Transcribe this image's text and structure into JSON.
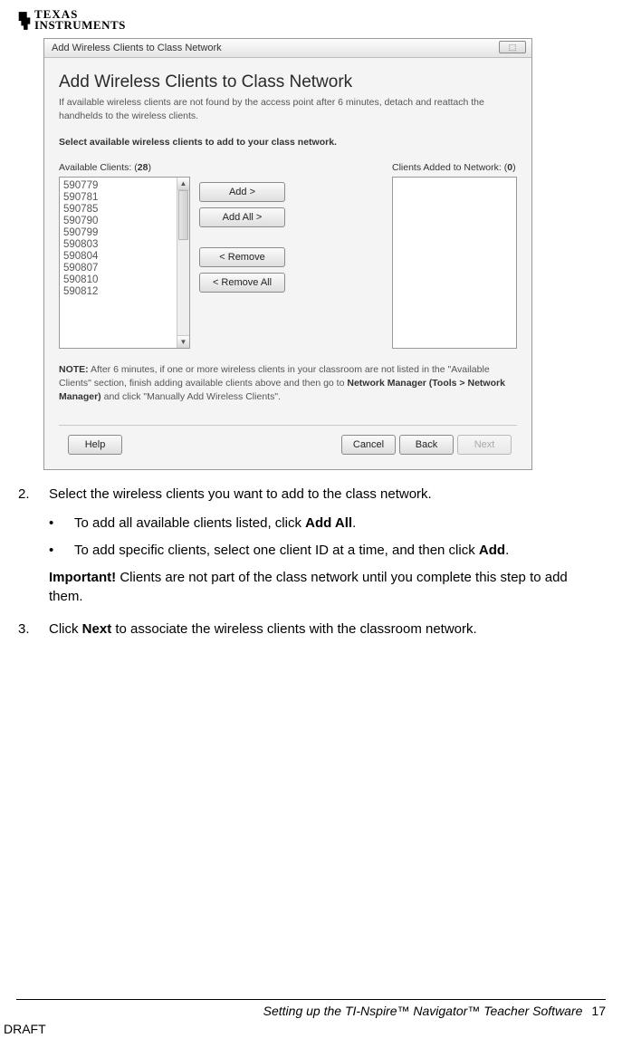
{
  "logo": {
    "line1": "TEXAS",
    "line2": "INSTRUMENTS"
  },
  "dialog": {
    "titlebar": "Add Wireless Clients to Class Network",
    "close_glyph": "⬚",
    "heading": "Add Wireless Clients to Class Network",
    "sub": "If available wireless clients are not found by the access point after 6 minutes, detach and reattach the handhelds to the wireless clients.",
    "instruction": "Select available wireless clients to add to your class network.",
    "avail_label": "Available Clients: (",
    "avail_count": "28",
    "avail_close": ")",
    "added_label": "Clients Added to Network: (",
    "added_count": "0",
    "added_close": ")",
    "clients": [
      "590779",
      "590781",
      "590785",
      "590790",
      "590799",
      "590803",
      "590804",
      "590807",
      "590810",
      "590812"
    ],
    "btn_add": "Add >",
    "btn_addall": "Add All >",
    "btn_remove": "< Remove",
    "btn_removeall": "< Remove All",
    "note_label": "NOTE:",
    "note_text": "  After 6 minutes, if one or more wireless clients in your classroom are not listed in the \"Available Clients\" section, finish adding available clients above and then go to ",
    "note_bold": "Network Manager (Tools > Network Manager)",
    "note_tail": " and click \"Manually Add Wireless Clients\".",
    "help": "Help",
    "cancel": "Cancel",
    "back": "Back",
    "next": "Next"
  },
  "steps": {
    "s2num": "2.",
    "s2": "Select the wireless clients you want to add to the class network.",
    "b1a": "To add all available clients listed, click ",
    "b1b": "Add All",
    "b1c": ".",
    "b2a": "To add specific clients, select one client ID at a time, and then click ",
    "b2b": "Add",
    "b2c": ".",
    "imp_label": "Important!",
    "imp_text": " Clients are not part of the class network until you complete this step to add them.",
    "s3num": "3.",
    "s3a": "Click ",
    "s3b": "Next",
    "s3c": " to associate the wireless clients with the classroom network."
  },
  "footer": {
    "title": "Setting up the TI-Nspire™ Navigator™ Teacher Software",
    "page": "17",
    "draft": "DRAFT"
  }
}
